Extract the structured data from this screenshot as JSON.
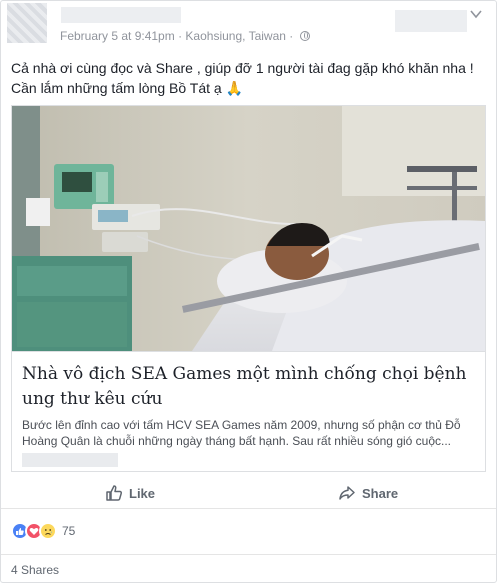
{
  "post": {
    "timestamp": "February 5 at 9:41pm",
    "separator": "·",
    "location": "Kaohsiung, Taiwan",
    "separator2": "·",
    "message_line1": "Cả nhà ơi cùng đọc và Share , giúp đỡ 1 người tài đag gặp khó khăn nha !",
    "message_line2": "Cần lắm những tấm lòng Bồ Tát ạ 🙏"
  },
  "link_card": {
    "image_alt": "Patient lying in hospital bed",
    "title": "Nhà vô địch SEA Games một mình chống chọi bệnh ung thư kêu cứu",
    "description_line1": "Bước lên đỉnh cao với tấm HCV SEA Games năm 2009, nhưng số phận cơ thủ Đỗ",
    "description_line2": "Hoàng Quân là chuỗi những ngày tháng bất hạnh. Sau rất nhiều sóng gió cuộc..."
  },
  "actions": {
    "like_label": "Like",
    "share_label": "Share"
  },
  "reactions": {
    "icons": [
      "like-reaction-icon",
      "love-reaction-icon",
      "sad-reaction-icon"
    ],
    "count": "75"
  },
  "shares": {
    "label": "4 Shares"
  },
  "colors": {
    "meta_gray": "#90949c",
    "action_gray": "#606770",
    "like_blue": "#4a81f5",
    "love_red": "#f25268",
    "sad_yellow": "#fcd85c"
  }
}
